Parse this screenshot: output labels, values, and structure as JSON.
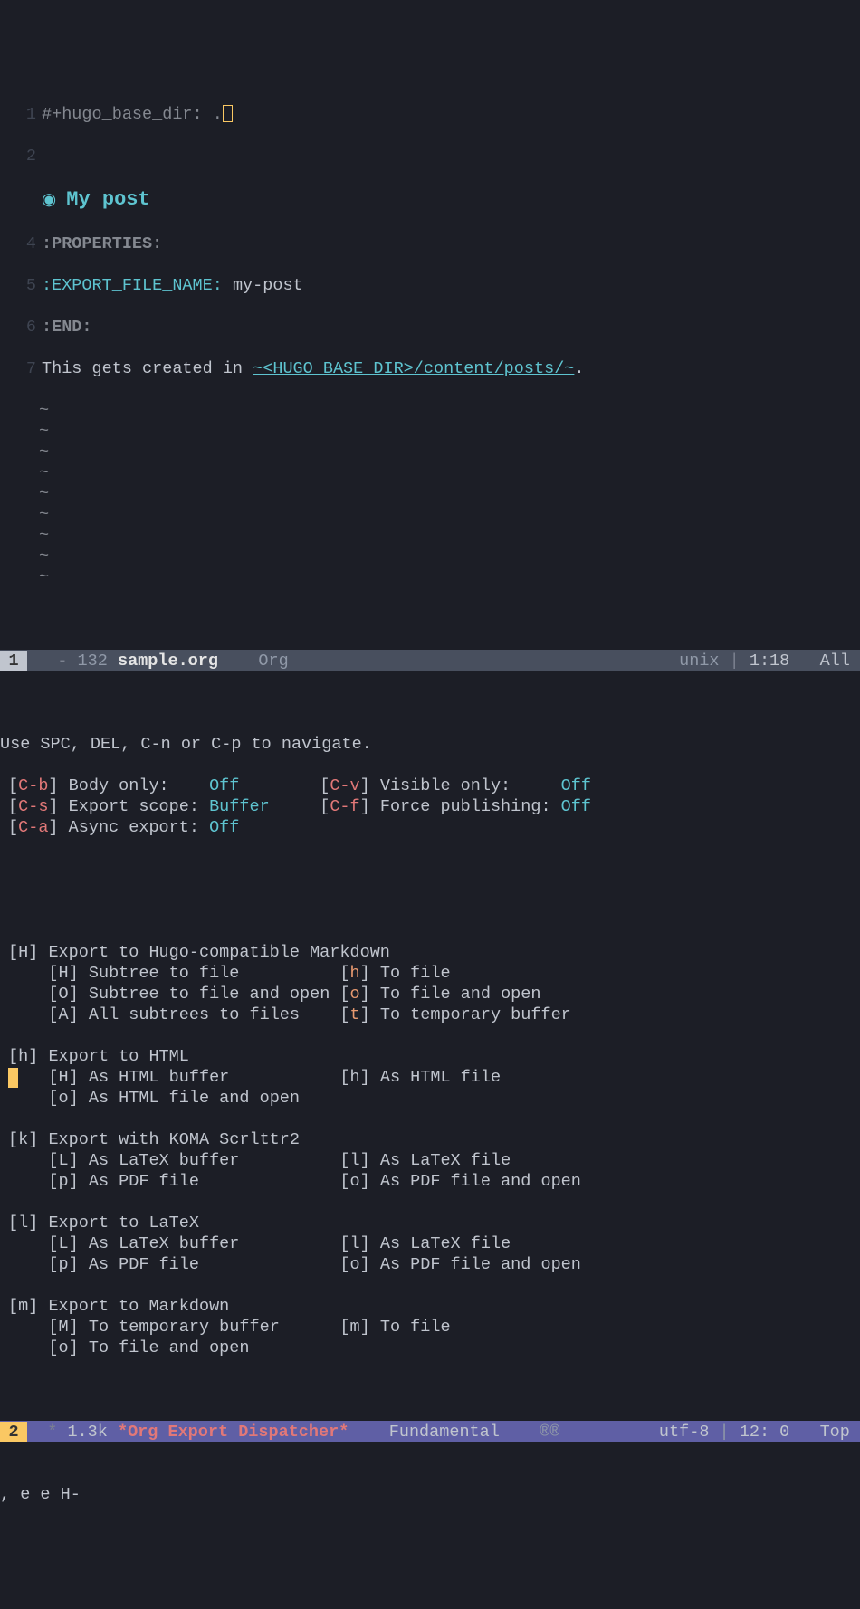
{
  "editor": {
    "lines": [
      {
        "num": "1",
        "type": "hugo",
        "dir_key": "#+hugo_base_dir:",
        "dir_val": "."
      },
      {
        "num": "2",
        "type": "blank"
      },
      {
        "num": "",
        "type": "heading",
        "bullet": "◉",
        "text": "My post"
      },
      {
        "num": "4",
        "type": "prop",
        "text": ":PROPERTIES:"
      },
      {
        "num": "5",
        "type": "propkv",
        "key": ":EXPORT_FILE_NAME:",
        "val": "my-post"
      },
      {
        "num": "6",
        "type": "prop",
        "text": ":END:"
      },
      {
        "num": "7",
        "type": "body",
        "pre": "This gets created in ",
        "link": "~<HUGO_BASE_DIR>/content/posts/~",
        "post": "."
      }
    ],
    "tilde_count": 9,
    "tilde": "~"
  },
  "modeline1": {
    "num": "1",
    "dash": " -",
    "size": "132",
    "filename": "sample.org",
    "mode": "Org",
    "encoding": "unix",
    "pos": "1:18",
    "scroll": "All"
  },
  "dispatcher": {
    "nav_hint": "Use SPC, DEL, C-n or C-p to navigate.",
    "options": [
      {
        "k1": "C-b",
        "l1": "Body only:",
        "v1": "Off",
        "k2": "C-v",
        "l2": "Visible only:",
        "v2": "Off"
      },
      {
        "k1": "C-s",
        "l1": "Export scope:",
        "v1": "Buffer",
        "k2": "C-f",
        "l2": "Force publishing:",
        "v2": "Off"
      },
      {
        "k1": "C-a",
        "l1": "Async export:",
        "v1": "Off"
      }
    ],
    "groups": [
      {
        "key": "H",
        "title": "Export to Hugo-compatible Markdown",
        "rows": [
          {
            "k1": "H",
            "c1": "upper",
            "l1": "Subtree to file",
            "k2": "h",
            "c2": "lower",
            "l2": "To file"
          },
          {
            "k1": "O",
            "c1": "upper",
            "l1": "Subtree to file and open",
            "k2": "o",
            "c2": "lower",
            "l2": "To file and open"
          },
          {
            "k1": "A",
            "c1": "upper",
            "l1": "All subtrees to files",
            "k2": "t",
            "c2": "lower",
            "l2": "To temporary buffer"
          }
        ]
      },
      {
        "key": "h",
        "title": "Export to HTML",
        "hl": true,
        "rows": [
          {
            "k1": "H",
            "c1": "upper",
            "l1": "As HTML buffer",
            "k2": "h",
            "c2": "upper",
            "l2": "As HTML file"
          },
          {
            "k1": "o",
            "c1": "upper",
            "l1": "As HTML file and open"
          }
        ]
      },
      {
        "key": "k",
        "title": "Export with KOMA Scrlttr2",
        "rows": [
          {
            "k1": "L",
            "c1": "upper",
            "l1": "As LaTeX buffer",
            "k2": "l",
            "c2": "upper",
            "l2": "As LaTeX file"
          },
          {
            "k1": "p",
            "c1": "upper",
            "l1": "As PDF file",
            "k2": "o",
            "c2": "upper",
            "l2": "As PDF file and open"
          }
        ]
      },
      {
        "key": "l",
        "title": "Export to LaTeX",
        "rows": [
          {
            "k1": "L",
            "c1": "upper",
            "l1": "As LaTeX buffer",
            "k2": "l",
            "c2": "upper",
            "l2": "As LaTeX file"
          },
          {
            "k1": "p",
            "c1": "upper",
            "l1": "As PDF file",
            "k2": "o",
            "c2": "upper",
            "l2": "As PDF file and open"
          }
        ]
      },
      {
        "key": "m",
        "title": "Export to Markdown",
        "rows": [
          {
            "k1": "M",
            "c1": "upper",
            "l1": "To temporary buffer",
            "k2": "m",
            "c2": "upper",
            "l2": "To file"
          },
          {
            "k1": "o",
            "c1": "upper",
            "l1": "To file and open"
          }
        ]
      }
    ]
  },
  "modeline2": {
    "num": "2",
    "star": "*",
    "size": "1.3k",
    "buffer": "*Org Export Dispatcher*",
    "mode": "Fundamental",
    "reg": "®®",
    "encoding": "utf-8",
    "pos": "12: 0",
    "scroll": "Top"
  },
  "echo": ", e e H-"
}
